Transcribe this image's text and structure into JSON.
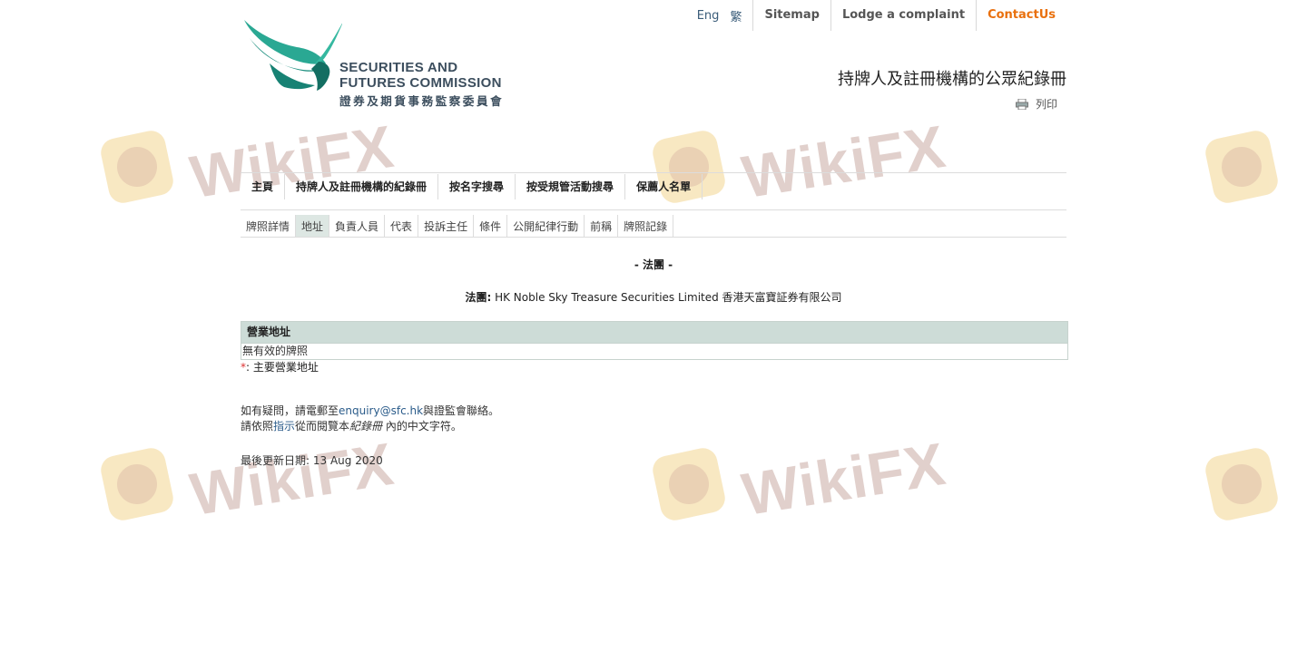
{
  "topbar": {
    "lang_en": "Eng",
    "lang_zh": "繁",
    "sitemap": "Sitemap",
    "complaint": "Lodge a complaint",
    "contact": "ContactUs"
  },
  "logo": {
    "line1": "SECURITIES AND",
    "line2": "FUTURES COMMISSION",
    "line3": "證券及期貨事務監察委員會"
  },
  "page_title": "持牌人及註冊機構的公眾紀錄冊",
  "print_label": "列印",
  "main_nav": [
    "主頁",
    "持牌人及註冊機構的紀錄冊",
    "按名字搜尋",
    "按受規管活動搜尋",
    "保薦人名單"
  ],
  "sub_tabs": [
    "牌照詳情",
    "地址",
    "負責人員",
    "代表",
    "投訴主任",
    "條件",
    "公開紀律行動",
    "前稱",
    "牌照記錄"
  ],
  "active_tab": "地址",
  "section_title": "- 法團 -",
  "corp_label": "法團:",
  "corp_name": "HK Noble Sky Treasure Securities Limited 香港天富寶証券有限公司",
  "address_table": {
    "header": "營業地址",
    "row": "無有效的牌照"
  },
  "note_star": "*",
  "note_text": ": 主要營業地址",
  "enquiry": {
    "prefix": "如有疑問，請電郵至",
    "email": "enquiry@sfc.hk",
    "suffix": "與證監會聯絡。",
    "line2_prefix": "請依照",
    "line2_link": "指示",
    "line2_mid": "從而閱覽本",
    "line2_italic": "紀錄冊",
    "line2_suffix": " 內的中文字符。"
  },
  "updated": "最後更新日期: 13 Aug 2020",
  "watermark_text": "WikiFX",
  "colors": {
    "accent_orange": "#e9700d",
    "logo_teal": "#1a9e8a",
    "table_header": "#cddcd7",
    "active_tab": "#dde7e3"
  }
}
